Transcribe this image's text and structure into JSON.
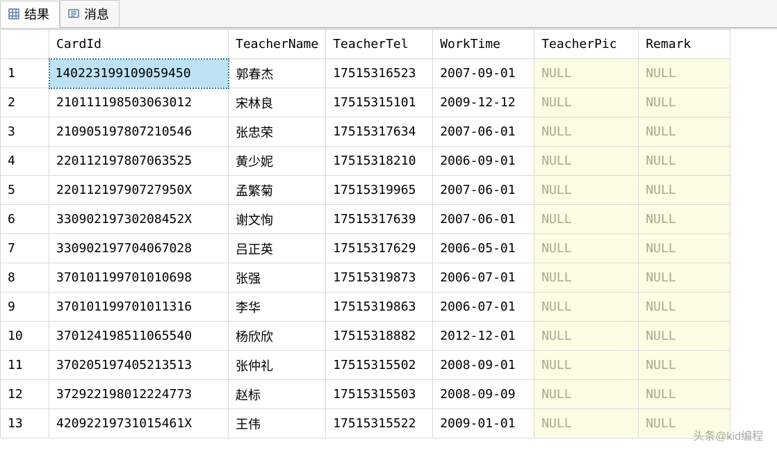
{
  "tabs": {
    "results": {
      "label": "结果"
    },
    "messages": {
      "label": "消息"
    }
  },
  "columns": {
    "cardid": "CardId",
    "tname": "TeacherName",
    "ttel": "TeacherTel",
    "wtime": "WorkTime",
    "tpic": "TeacherPic",
    "remark": "Remark"
  },
  "null_text": "NULL",
  "rows": [
    {
      "n": "1",
      "cardid": "140223199109059450",
      "tname": "郭春杰",
      "ttel": "17515316523",
      "wtime": "2007-09-01",
      "tpic": null,
      "remark": null
    },
    {
      "n": "2",
      "cardid": "210111198503063012",
      "tname": "宋林良",
      "ttel": "17515315101",
      "wtime": "2009-12-12",
      "tpic": null,
      "remark": null
    },
    {
      "n": "3",
      "cardid": "210905197807210546",
      "tname": "张忠荣",
      "ttel": "17515317634",
      "wtime": "2007-06-01",
      "tpic": null,
      "remark": null
    },
    {
      "n": "4",
      "cardid": "220112197807063525",
      "tname": "黄少妮",
      "ttel": "17515318210",
      "wtime": "2006-09-01",
      "tpic": null,
      "remark": null
    },
    {
      "n": "5",
      "cardid": "22011219790727950X",
      "tname": "孟繁菊",
      "ttel": "17515319965",
      "wtime": "2007-06-01",
      "tpic": null,
      "remark": null
    },
    {
      "n": "6",
      "cardid": "33090219730208452X",
      "tname": "谢文恂",
      "ttel": "17515317639",
      "wtime": "2007-06-01",
      "tpic": null,
      "remark": null
    },
    {
      "n": "7",
      "cardid": "330902197704067028",
      "tname": "吕正英",
      "ttel": "17515317629",
      "wtime": "2006-05-01",
      "tpic": null,
      "remark": null
    },
    {
      "n": "8",
      "cardid": "370101199701010698",
      "tname": "张强",
      "ttel": "17515319873",
      "wtime": "2006-07-01",
      "tpic": null,
      "remark": null
    },
    {
      "n": "9",
      "cardid": "370101199701011316",
      "tname": "李华",
      "ttel": "17515319863",
      "wtime": "2006-07-01",
      "tpic": null,
      "remark": null
    },
    {
      "n": "10",
      "cardid": "370124198511065540",
      "tname": "杨欣欣",
      "ttel": "17515318882",
      "wtime": "2012-12-01",
      "tpic": null,
      "remark": null
    },
    {
      "n": "11",
      "cardid": "370205197405213513",
      "tname": "张仲礼",
      "ttel": "17515315502",
      "wtime": "2008-09-01",
      "tpic": null,
      "remark": null
    },
    {
      "n": "12",
      "cardid": "372922198012224773",
      "tname": "赵标",
      "ttel": "17515315503",
      "wtime": "2008-09-09",
      "tpic": null,
      "remark": null
    },
    {
      "n": "13",
      "cardid": "42092219731015461X",
      "tname": "王伟",
      "ttel": "17515315522",
      "wtime": "2009-01-01",
      "tpic": null,
      "remark": null
    }
  ],
  "watermark": "头条@kid编程"
}
